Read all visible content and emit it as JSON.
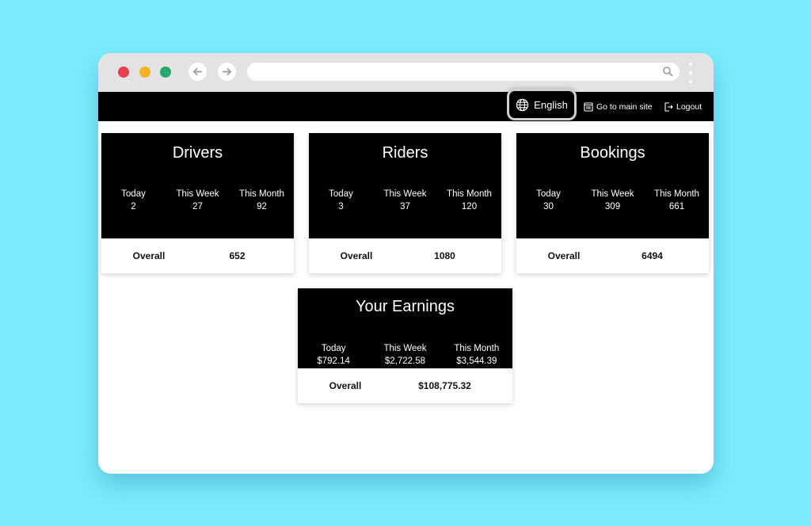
{
  "browser": {
    "traffic_lights": {
      "close": "#e8404f",
      "minimize": "#f5b324",
      "maximize": "#27a86b"
    },
    "back_icon": "arrow-left",
    "forward_icon": "arrow-right",
    "url": "",
    "search_icon": "magnifier",
    "menu_icon": "vertical-dots"
  },
  "header": {
    "language": "English",
    "main_site": "Go to main site",
    "logout": "Logout"
  },
  "cards": [
    {
      "title": "Drivers",
      "stats": [
        {
          "label": "Today",
          "value": "2"
        },
        {
          "label": "This Week",
          "value": "27"
        },
        {
          "label": "This Month",
          "value": "92"
        }
      ],
      "overall_label": "Overall",
      "overall_value": "652"
    },
    {
      "title": "Riders",
      "stats": [
        {
          "label": "Today",
          "value": "3"
        },
        {
          "label": "This Week",
          "value": "37"
        },
        {
          "label": "This Month",
          "value": "120"
        }
      ],
      "overall_label": "Overall",
      "overall_value": "1080"
    },
    {
      "title": "Bookings",
      "stats": [
        {
          "label": "Today",
          "value": "30"
        },
        {
          "label": "This Week",
          "value": "309"
        },
        {
          "label": "This Month",
          "value": "661"
        }
      ],
      "overall_label": "Overall",
      "overall_value": "6494"
    }
  ],
  "earnings": {
    "title": "Your Earnings",
    "stats": [
      {
        "label": "Today",
        "value": "$792.14"
      },
      {
        "label": "This Week",
        "value": "$2,722.58"
      },
      {
        "label": "This Month",
        "value": "$3,544.39"
      }
    ],
    "overall_label": "Overall",
    "overall_value": "$108,775.32"
  }
}
